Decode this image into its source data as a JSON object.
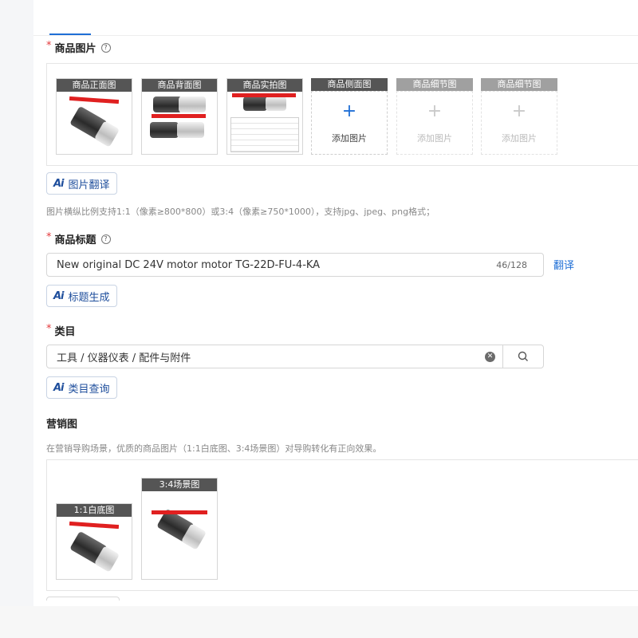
{
  "images_section": {
    "title": "商品图片",
    "slots": [
      {
        "label": "商品正面图"
      },
      {
        "label": "商品背面图"
      },
      {
        "label": "商品实拍图"
      },
      {
        "label": "商品侧面图",
        "add_text": "添加图片"
      },
      {
        "label": "商品细节图",
        "add_text": "添加图片"
      },
      {
        "label": "商品细节图",
        "add_text": "添加图片"
      }
    ],
    "translate_button": "图片翻译",
    "hint": "图片横纵比例支持1:1（像素≥800*800）或3:4（像素≥750*1000），支持jpg、jpeg、png格式；"
  },
  "title_section": {
    "title": "商品标题",
    "value": "New original DC 24V motor motor TG-22D-FU-4-KA",
    "count": "46/128",
    "translate_link": "翻译",
    "generate_button": "标题生成"
  },
  "category_section": {
    "title": "类目",
    "value": "工具 / 仪器仪表 / 配件与附件",
    "query_button": "类目查询"
  },
  "marketing_section": {
    "title": "营销图",
    "hint": "在营销导购场景，优质的商品图片（1:1白底图、3:4场景图）对导购转化有正向效果。",
    "slots": [
      {
        "label": "1:1白底图"
      },
      {
        "label": "3:4场景图"
      }
    ]
  },
  "ai_mark": "Ai",
  "icons": {
    "help": "question-circle-icon",
    "plus": "plus-icon",
    "clear": "clear-circle-icon",
    "search": "search-icon"
  },
  "colors": {
    "accent": "#1f6fd6",
    "required": "#e4393c",
    "ai_text": "#1e4e9c"
  }
}
